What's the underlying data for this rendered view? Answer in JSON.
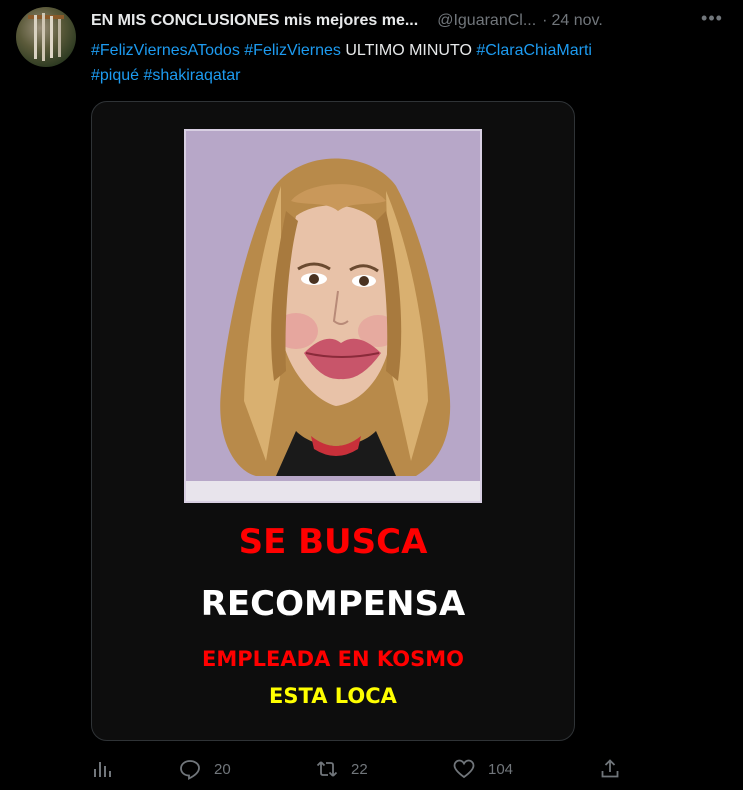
{
  "tweet": {
    "display_name": "EN MIS CONCLUSIONES mis mejores me...",
    "handle": "@IguaranCl...",
    "separator": "·",
    "date": "24 nov.",
    "more_label": "•••",
    "text": {
      "hashtag1": "#FelizViernesATodos",
      "hashtag2": "#FelizViernes",
      "plain": "ULTIMO MINUTO",
      "hashtag3": "#ClaraChiaMarti",
      "hashtag4": "#piqué",
      "hashtag5": "#shakiraqatar"
    }
  },
  "media": {
    "line1": "SE BUSCA",
    "line2": "RECOMPENSA",
    "line3": "EMPLEADA EN KOSMO",
    "line4": "ESTA LOCA",
    "colors": {
      "red": "#ff0000",
      "white": "#ffffff",
      "yellow": "#ffff00",
      "poster_bg": "#b7a7c8"
    }
  },
  "actions": {
    "analytics_icon": "analytics-icon",
    "reply_count": "20",
    "retweet_count": "22",
    "like_count": "104",
    "share_icon": "share-icon"
  },
  "colors": {
    "background": "#000000",
    "text": "#e7e9ea",
    "secondary": "#71767b",
    "link": "#1d9bf0"
  }
}
